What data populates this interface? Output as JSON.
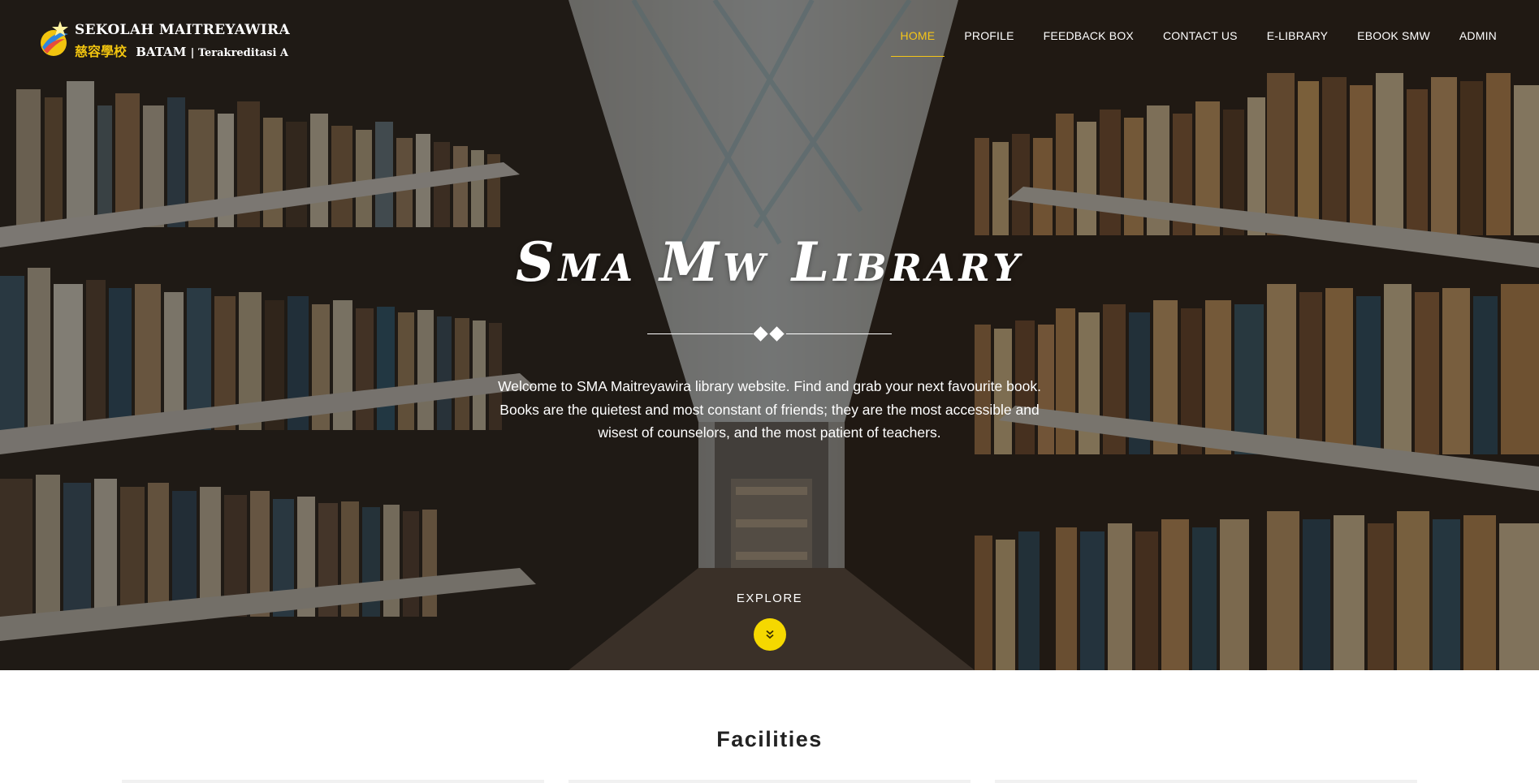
{
  "brand": {
    "name": "SEKOLAH MAITREYAWIRA",
    "chinese": "慈容學校",
    "city": "BATAM",
    "accreditation": "| Terakreditasi A",
    "logo_icon": "school-logo-star-icon"
  },
  "nav": {
    "items": [
      {
        "label": "HOME",
        "active": true
      },
      {
        "label": "PROFILE",
        "active": false
      },
      {
        "label": "FEEDBACK BOX",
        "active": false
      },
      {
        "label": "CONTACT US",
        "active": false
      },
      {
        "label": "E-LIBRARY",
        "active": false
      },
      {
        "label": "EBOOK SMW",
        "active": false
      },
      {
        "label": "ADMIN",
        "active": false
      }
    ]
  },
  "hero": {
    "title": "Sma Mw Library",
    "description": "Welcome to SMA Maitreyawira library website. Find and grab your next favourite book. Books are the quietest and most constant of friends; they are the most accessible and wisest of counselors, and the most patient of teachers.",
    "explore_label": "EXPLORE",
    "explore_icon": "double-chevron-down-icon"
  },
  "sections": {
    "facilities_title": "Facilities"
  },
  "colors": {
    "accent": "#f5c518",
    "explore_button": "#f5d800",
    "hero_overlay": "#141210",
    "text_light": "#ffffff",
    "text_dark": "#222222"
  }
}
